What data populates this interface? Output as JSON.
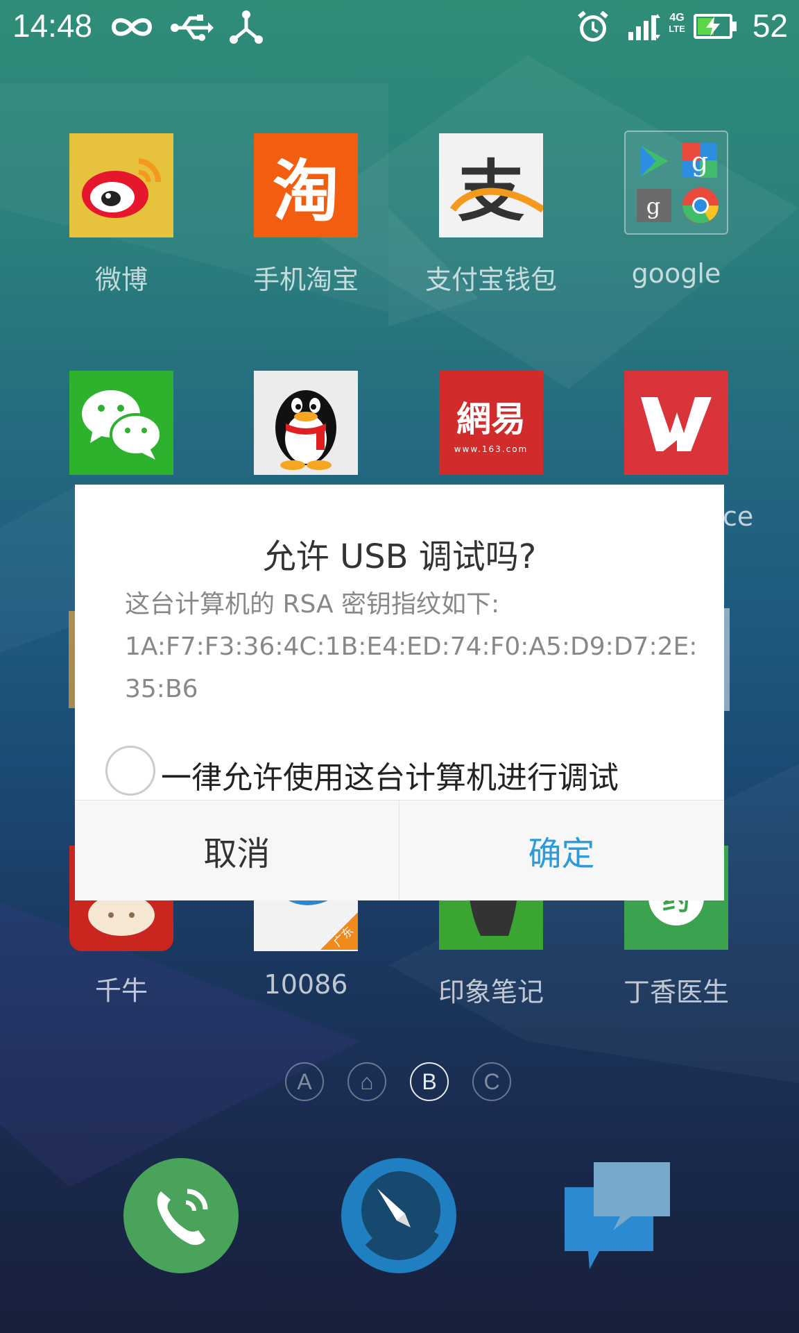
{
  "status_bar": {
    "time": "14:48",
    "battery_percent": "52",
    "battery_level": 0.52,
    "icons": [
      "infinity-icon",
      "usb-icon",
      "share-icon",
      "alarm-icon",
      "signal-icon",
      "4g-lte-icon",
      "battery-charging-icon"
    ],
    "network_label": "4G",
    "network_sub": "LTE"
  },
  "apps": {
    "weibo": {
      "label": "微博"
    },
    "taobao": {
      "label": "手机淘宝",
      "glyph": "淘"
    },
    "alipay": {
      "label": "支付宝钱包",
      "glyph": "支"
    },
    "google": {
      "label": "google"
    },
    "wechat": {
      "label": ""
    },
    "qq": {
      "label": ""
    },
    "netease": {
      "label": "",
      "glyph": "網易",
      "sub": "www.163.com"
    },
    "wps": {
      "label": "ce",
      "glyph": "W"
    },
    "qianniu": {
      "label": "千牛"
    },
    "cmcc": {
      "label": "10086",
      "badge": "广东"
    },
    "evernote": {
      "label": "印象笔记"
    },
    "dxy": {
      "label": "丁香医生",
      "glyph": "约"
    }
  },
  "dialog": {
    "title": "允许 USB 调试吗?",
    "message_line1": "这台计算机的 RSA 密钥指纹如下:",
    "message_line2": "1A:F7:F3:36:4C:1B:E4:ED:74:F0:A5:D9:D7:2E:",
    "message_line3": "35:B6",
    "checkbox_label": "一律允许使用这台计算机进行调试",
    "checkbox_checked": false,
    "cancel_label": "取消",
    "ok_label": "确定",
    "accent_color": "#2e9ad8"
  },
  "pager": {
    "dots": [
      {
        "label": "A",
        "active": false
      },
      {
        "label": "⌂",
        "active": false
      },
      {
        "label": "B",
        "active": true
      },
      {
        "label": "C",
        "active": false
      }
    ]
  },
  "dock": {
    "items": [
      "phone-icon",
      "browser-compass-icon",
      "messages-icon"
    ],
    "colors": {
      "phone": "#4aa35a",
      "browser": "#1f7fc1",
      "messages": "#2c8bd0"
    }
  }
}
